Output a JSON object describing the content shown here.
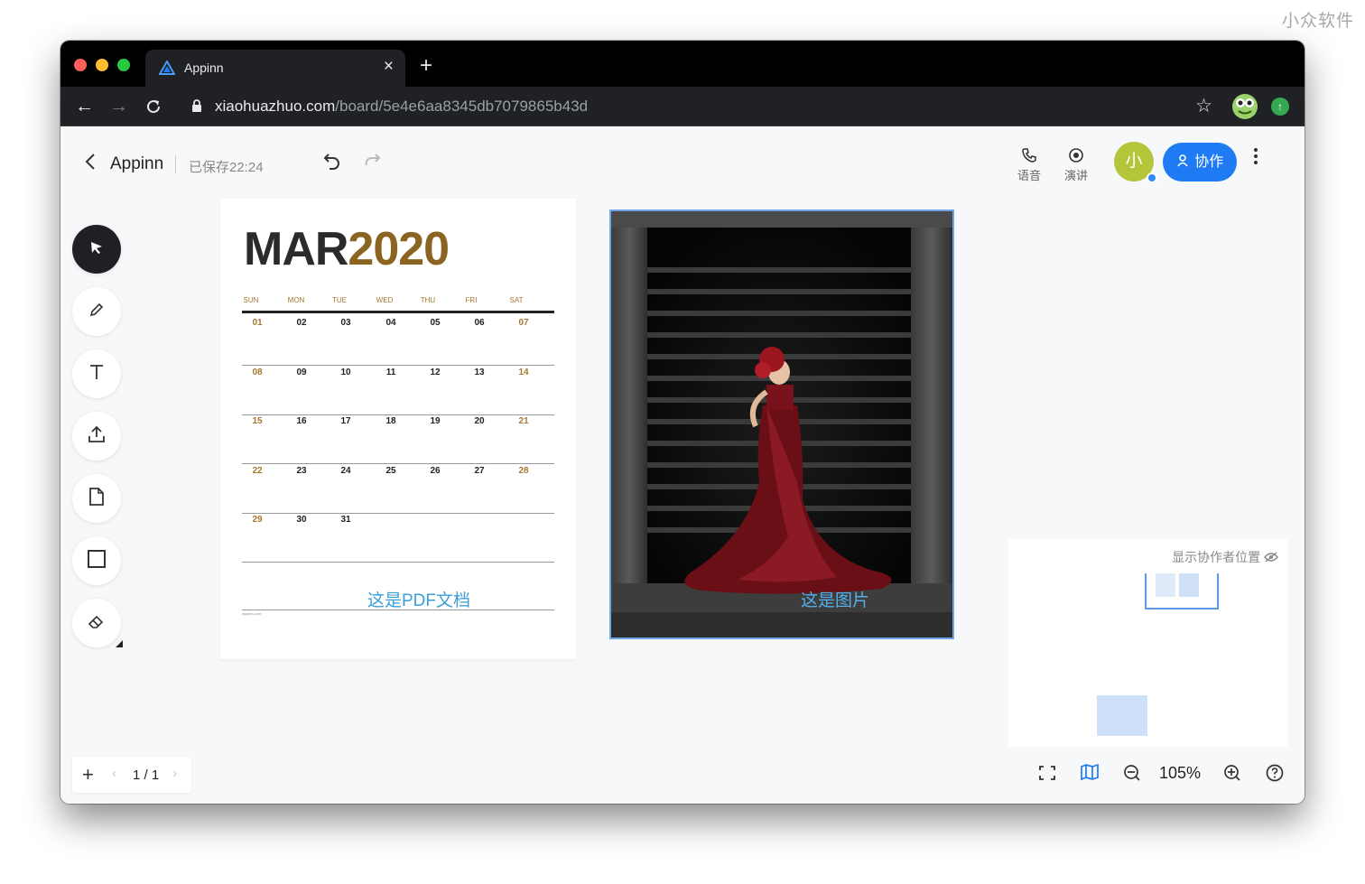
{
  "watermark": "小众软件",
  "browser": {
    "tab_title": "Appinn",
    "url_host": "xiaohuazhuo.com",
    "url_path": "/board/5e4e6aa8345db7079865b43d"
  },
  "header": {
    "doc_title": "Appinn",
    "saved_status": "已保存22:24",
    "voice_label": "语音",
    "present_label": "演讲",
    "avatar_text": "小",
    "collab_label": "协作"
  },
  "calendar": {
    "month": "MAR",
    "year": "2020",
    "weekdays": [
      "SUN",
      "MON",
      "TUE",
      "WED",
      "THU",
      "FRI",
      "SAT"
    ],
    "weeks": [
      [
        "01",
        "02",
        "03",
        "04",
        "05",
        "06",
        "07"
      ],
      [
        "08",
        "09",
        "10",
        "11",
        "12",
        "13",
        "14"
      ],
      [
        "15",
        "16",
        "17",
        "18",
        "19",
        "20",
        "21"
      ],
      [
        "22",
        "23",
        "24",
        "25",
        "26",
        "27",
        "28"
      ],
      [
        "29",
        "30",
        "31",
        "",
        "",
        "",
        ""
      ]
    ],
    "label": "这是PDF文档",
    "footer": "Appinn.com"
  },
  "image_card": {
    "label": "这是图片"
  },
  "minimap": {
    "label": "显示协作者位置"
  },
  "pager": {
    "text": "1 / 1"
  },
  "zoom": {
    "value": "105%"
  },
  "colors": {
    "accent": "#1e7bf4",
    "selection": "#6fa6e8",
    "calendar_gold": "#8a6420"
  }
}
